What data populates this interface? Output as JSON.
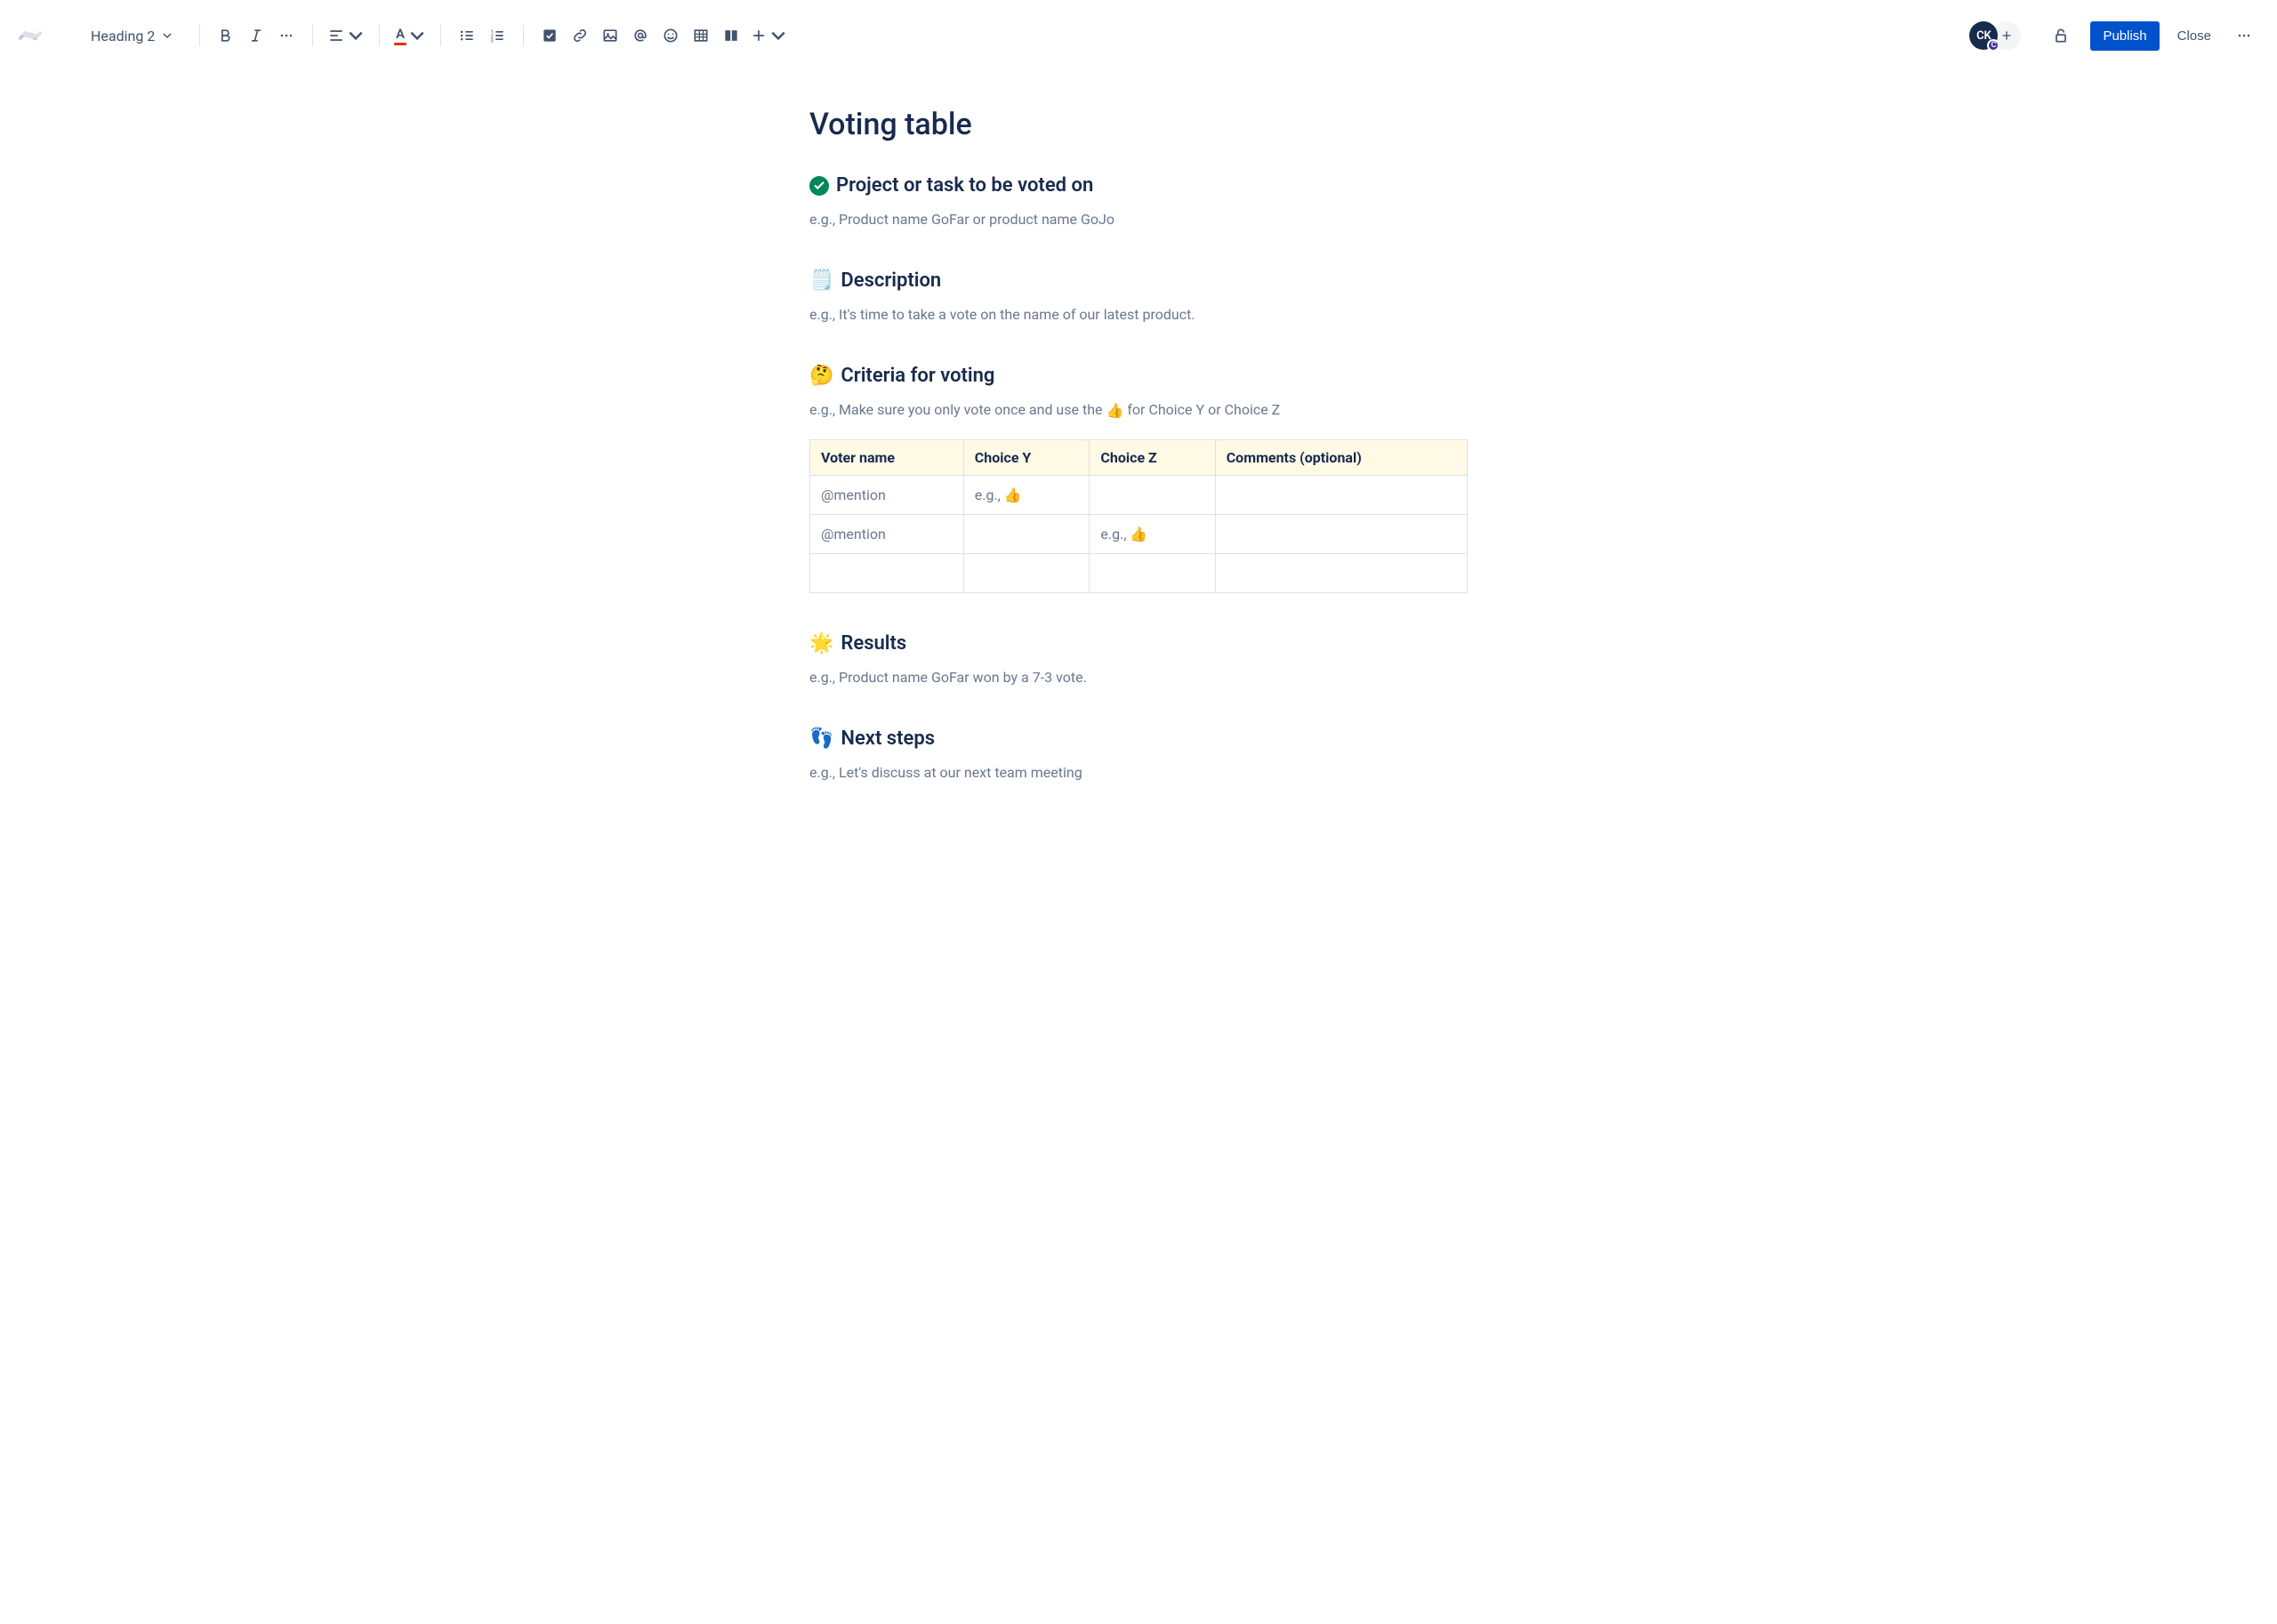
{
  "toolbar": {
    "text_style": "Heading 2",
    "publish_label": "Publish",
    "close_label": "Close"
  },
  "avatar": {
    "initials": "CK",
    "badge": "C"
  },
  "page": {
    "title": "Voting table"
  },
  "sections": {
    "project": {
      "heading": "Project or task to be voted on",
      "placeholder": "e.g., Product name GoFar or product name GoJo"
    },
    "description": {
      "emoji": "🗒️",
      "heading": "Description",
      "placeholder": "e.g., It's time to take a vote on the name of our latest product."
    },
    "criteria": {
      "emoji": "🤔",
      "heading": "Criteria for voting",
      "placeholder_pre": "e.g., Make sure you only vote once and use the ",
      "placeholder_emoji": "👍",
      "placeholder_post": " for Choice Y or Choice Z"
    },
    "results": {
      "emoji": "🌟",
      "heading": "Results",
      "placeholder": "e.g., Product name GoFar won by a 7-3 vote."
    },
    "next_steps": {
      "emoji": "👣",
      "heading": "Next steps",
      "placeholder": "e.g., Let's discuss at our next team meeting"
    }
  },
  "table": {
    "headers": {
      "voter": "Voter name",
      "choice_y": "Choice Y",
      "choice_z": "Choice Z",
      "comments": "Comments (optional)"
    },
    "rows": {
      "r0": {
        "voter": "@mention",
        "y": "e.g., 👍",
        "z": "",
        "comments": ""
      },
      "r1": {
        "voter": "@mention",
        "y": "",
        "z": "e.g., 👍",
        "comments": ""
      },
      "r2": {
        "voter": "",
        "y": "",
        "z": "",
        "comments": ""
      }
    }
  }
}
